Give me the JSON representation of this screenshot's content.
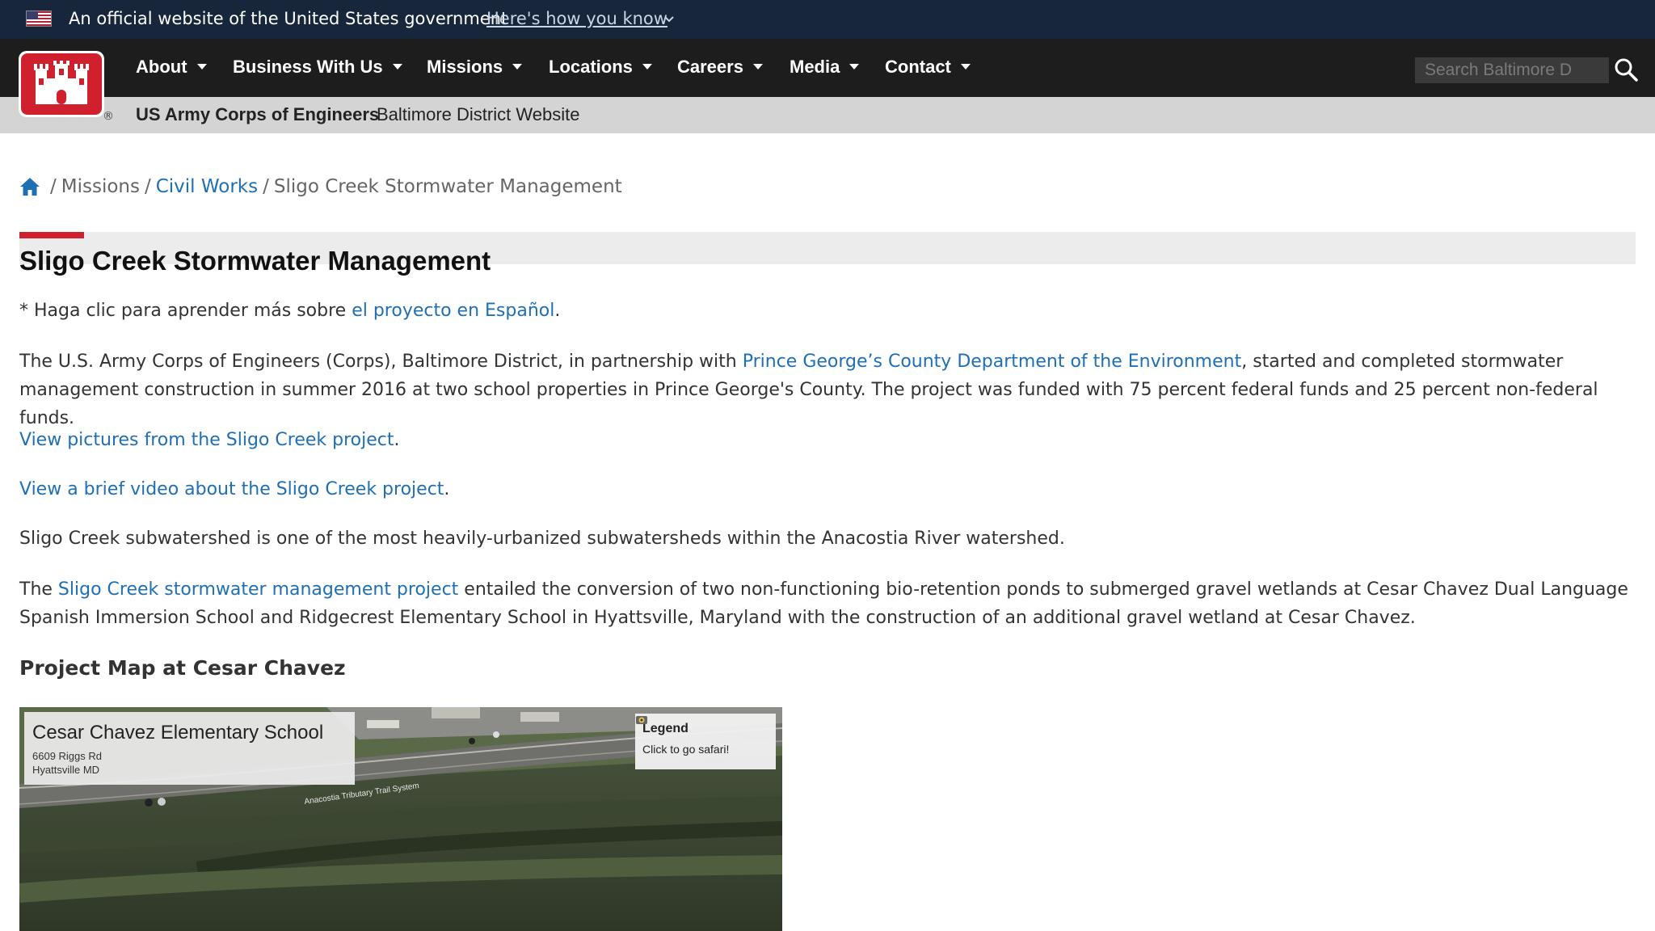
{
  "gov_banner": {
    "text": "An official website of the United States government",
    "link": "Here's how you know"
  },
  "nav": {
    "items": [
      {
        "label": "About"
      },
      {
        "label": "Business With Us"
      },
      {
        "label": "Missions"
      },
      {
        "label": "Locations"
      },
      {
        "label": "Careers"
      },
      {
        "label": "Media"
      },
      {
        "label": "Contact"
      }
    ],
    "search_placeholder": "Search Baltimore D"
  },
  "sub_bar": {
    "org": "US Army Corps of Engineers",
    "site": "Baltimore District Website"
  },
  "logo": {
    "reg_mark": "®"
  },
  "breadcrumb": {
    "items": [
      "Missions",
      "Civil Works",
      "Sligo Creek Stormwater Management"
    ]
  },
  "page": {
    "title": "Sligo Creek Stormwater Management",
    "spanish": {
      "prefix": "* Haga clic para aprender más sobre ",
      "link": "el proyecto en Español",
      "suffix": "."
    },
    "intro": {
      "prefix": "The U.S. Army Corps of Engineers (Corps), Baltimore District, in partnership with ",
      "link": "Prince George’s County Department of the Environment",
      "suffix": ", started and completed stormwater management construction in summer 2016 at two school properties in Prince George's County. The project was funded with 75 percent federal funds and 25 percent non-federal funds."
    },
    "pictures": {
      "link": "View pictures from the Sligo Creek project",
      "suffix": "."
    },
    "video": {
      "link": "View a brief video about the Sligo Creek project",
      "suffix": "."
    },
    "subwatershed": "Sligo Creek subwatershed is one of the most heavily-urbanized subwatersheds within the Anacostia River watershed.",
    "project": {
      "prefix": "The ",
      "link": "Sligo Creek stormwater management project",
      "suffix": " entailed the conversion of two non-functioning bio-retention ponds to submerged gravel wetlands at Cesar Chavez Dual Language Spanish Immersion School and Ridgecrest Elementary School in Hyattsville, Maryland with the construction of an additional gravel wetland at Cesar Chavez."
    },
    "map_heading": "Project Map at Cesar Chavez"
  },
  "map": {
    "info_title": "Cesar Chavez Elementary School",
    "address_1": "6609 Riggs Rd",
    "address_2": "Hyattsville MD",
    "legend_title": "Legend",
    "legend_item": "Click to go safari!",
    "trail_label": "Anacostia Tributary Trail System"
  },
  "colors": {
    "gov_banner_bg": "#17263b",
    "nav_bg": "#1d1d1d",
    "brand_red": "#d0202e",
    "link_blue": "#1f6fb5",
    "sub_bar_bg": "#d4d4d4"
  }
}
